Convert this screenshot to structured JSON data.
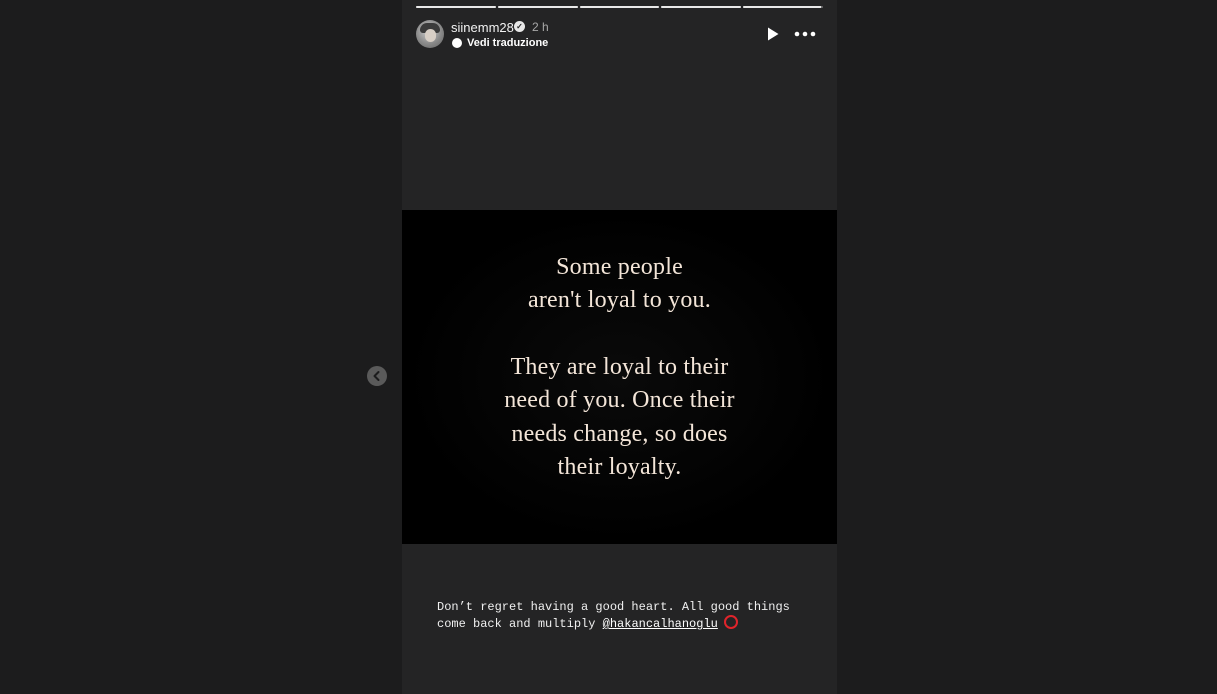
{
  "story": {
    "progress": [
      1,
      1,
      1,
      1,
      0.98
    ],
    "username": "siinemm28",
    "time": "2 h",
    "translate_label": "Vedi traduzione"
  },
  "quote": {
    "lines": [
      "Some people",
      "aren't loyal to you.",
      "They are loyal to their",
      "need of you. Once their",
      "needs change, so does",
      "their loyalty."
    ]
  },
  "caption": {
    "line1": "Don’t regret having a good heart. All good things",
    "line2_prefix": "come back and multiply ",
    "mention": "@hakancalhanoglu"
  },
  "icons": {
    "play": "play-icon",
    "more": "more-horizontal-icon",
    "prev": "chevron-left-icon",
    "verified": "verified-badge-icon",
    "translate": "translate-bubble-icon",
    "ring": "red-circle-emoji"
  },
  "colors": {
    "background": "#1c1c1d",
    "story_bg": "#242425",
    "quote_text": "#f3e5d8",
    "ring": "#e0242b"
  }
}
